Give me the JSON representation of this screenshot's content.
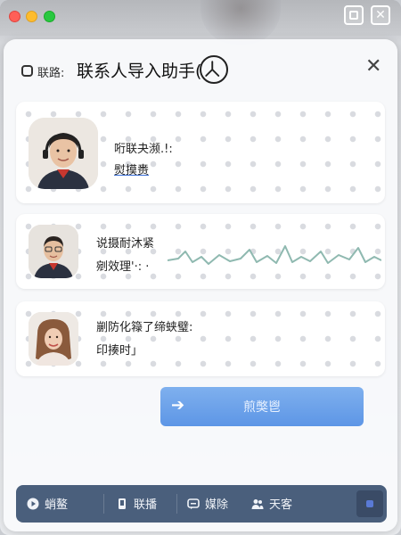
{
  "window": {
    "controls": [
      "close",
      "minimize",
      "maximize"
    ]
  },
  "header": {
    "prefix": "联路:",
    "title": "联系人导入助手(",
    "close_symbol": "✕"
  },
  "cards": [
    {
      "line1": "哘联夬濒.!:",
      "line2": "熨摸赉",
      "avatar": "man-with-headset"
    },
    {
      "line1": "说摄耐沐紧",
      "line2": "剜效理'·:  ·",
      "avatar": "man-with-glasses"
    },
    {
      "line1": "剻防化簶了缔蛱璧:",
      "line2": "印揍时」",
      "avatar": "woman-portrait"
    }
  ],
  "import_button": {
    "arrow": "➔",
    "label": "煎獘鬯"
  },
  "toolbar": {
    "items": [
      {
        "label": "蛸鳌",
        "icon": "play-circle-icon"
      },
      {
        "label": "联播",
        "icon": "phone-icon"
      },
      {
        "label": "媒除",
        "icon": "chat-icon"
      },
      {
        "label": "天客",
        "icon": "users-icon"
      }
    ]
  },
  "colors": {
    "accent": "#5d96e6",
    "toolbar": "#4a5f7c",
    "wave": "#7fb0a8"
  },
  "icons": [
    "shield-icon",
    "logo-icon",
    "close-icon",
    "arrow-right-icon",
    "waveform-icon",
    "verified-badge-icon"
  ]
}
